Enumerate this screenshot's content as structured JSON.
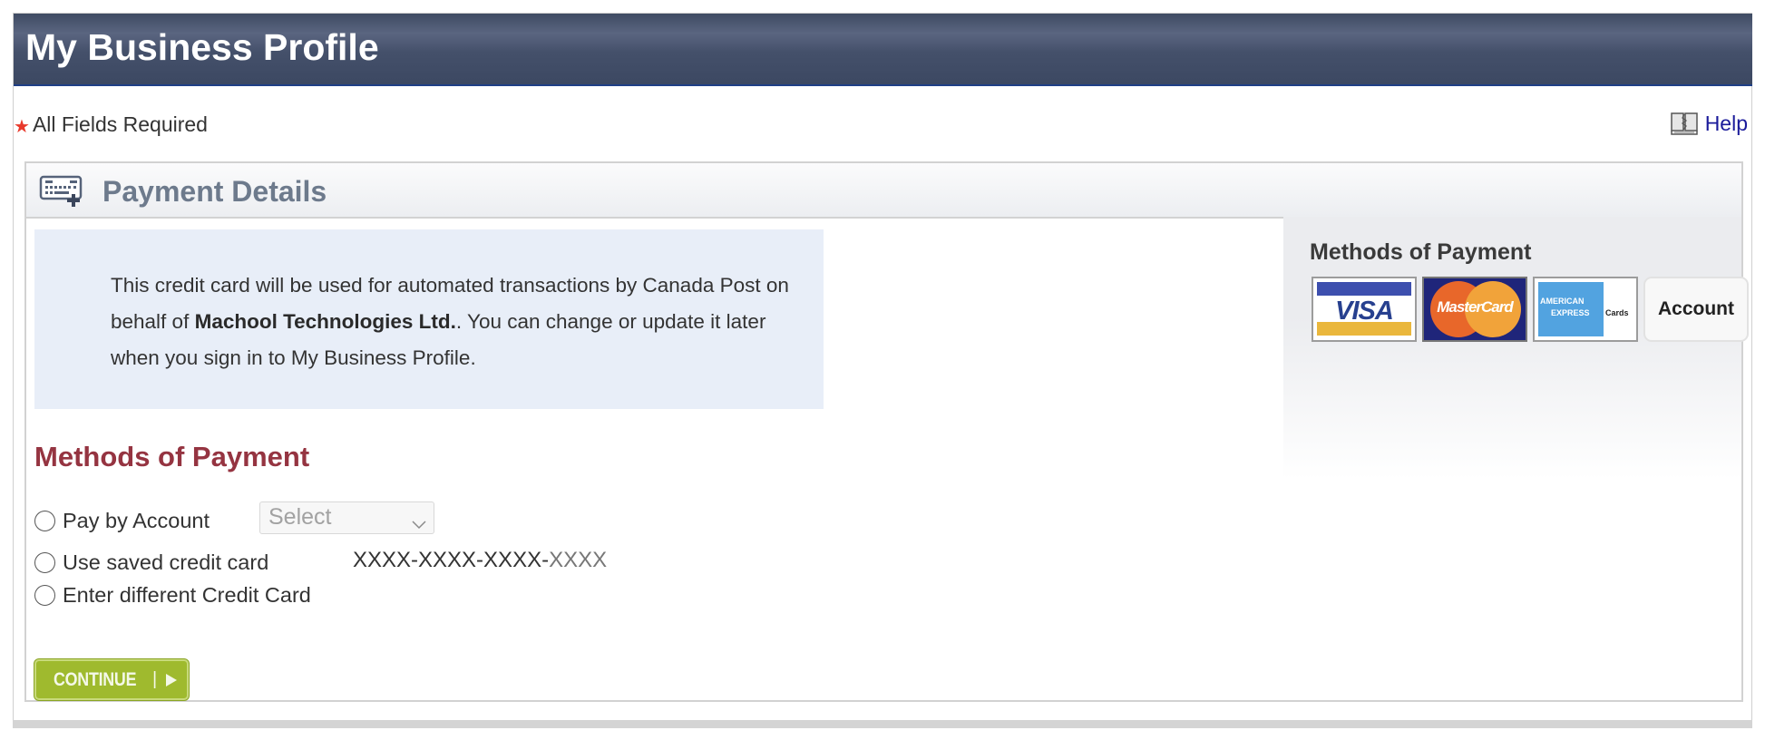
{
  "header": {
    "title": "My Business Profile"
  },
  "required_note": {
    "star": "★",
    "label": "All Fields Required"
  },
  "help": {
    "icon": "book-icon",
    "label": "Help"
  },
  "panel": {
    "icon": "keyboard-add-icon",
    "title": "Payment Details",
    "info": {
      "before": "This credit card will be used for automated transactions by Canada Post on behalf of ",
      "company": "Machool Technologies Ltd.",
      "after": ". You can change or update it later when you sign in to My Business Profile."
    },
    "methods_title": "Methods of Payment",
    "options": [
      {
        "label": "Pay by Account",
        "selected": false
      },
      {
        "label": "Use saved credit card",
        "selected": false
      },
      {
        "label": "Enter different Credit Card",
        "selected": false
      }
    ],
    "account_select": {
      "value": "Select"
    },
    "saved_card": {
      "masked": "XXXX-XXXX-XXXX-",
      "last": "XXXX"
    },
    "continue_label": "CONTINUE",
    "continue_sep": "|"
  },
  "side": {
    "title": "Methods of Payment",
    "cards": [
      {
        "name": "VISA",
        "icon": "visa-logo"
      },
      {
        "name": "MasterCard",
        "icon": "mastercard-logo"
      },
      {
        "name": "AMERICAN EXPRESS Cards",
        "line1": "AMERICAN",
        "line2": "EXPRESS",
        "line3": "Cards",
        "icon": "amex-logo"
      },
      {
        "name": "Account",
        "icon": "account-badge"
      }
    ]
  },
  "colors": {
    "header_bg": "#3f4b63",
    "section_title": "#953441",
    "continue_bg": "#9fba2e",
    "info_bg": "#e8eef8",
    "help_link": "#1a1a9a",
    "required_star": "#e8392b"
  }
}
